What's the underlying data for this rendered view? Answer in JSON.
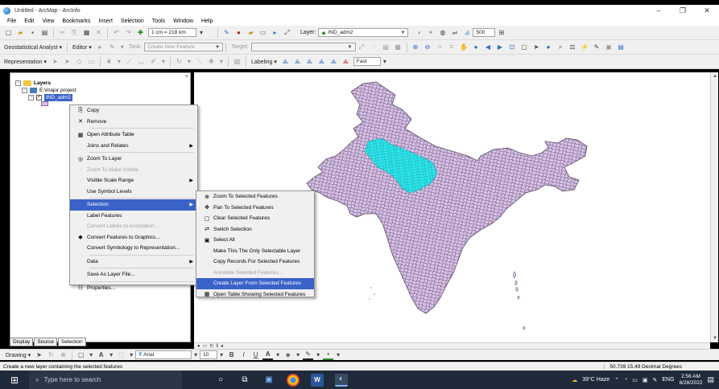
{
  "window": {
    "title": "Untitled - ArcMap - ArcInfo",
    "minimize": "–",
    "maximize": "❐",
    "close": "✕"
  },
  "menubar": [
    "File",
    "Edit",
    "View",
    "Bookmarks",
    "Insert",
    "Selection",
    "Tools",
    "Window",
    "Help"
  ],
  "toolbar1": {
    "scale": "1 cm = 218 km",
    "layer_label": "Layer:",
    "layer_value": "IND_adm2",
    "zoom_value": "500"
  },
  "toolbar2": {
    "geostat_label": "Geostatistical Analyst ▾",
    "editor_label": "Editor ▾",
    "task_label": "Task:",
    "task_value": "Create New Feature",
    "target_label": "Target:"
  },
  "toolbar3": {
    "representation_label": "Representation ▾",
    "labeling_label": "Labeling ▾",
    "fast_value": "Fast"
  },
  "toc": {
    "root": "Layers",
    "folder": "E:\\major project",
    "layer": "IND_adm2"
  },
  "toc_tabs": [
    "Display",
    "Source",
    "Selection"
  ],
  "context_menu": [
    {
      "label": "Copy",
      "icon": "copy-icon",
      "glyph": "⎘",
      "disabled": false,
      "submenu": false
    },
    {
      "label": "Remove",
      "icon": "remove-icon",
      "glyph": "✕",
      "disabled": false,
      "submenu": false
    },
    {
      "sep": true
    },
    {
      "label": "Open Attribute Table",
      "icon": "table-icon",
      "glyph": "▦",
      "disabled": false,
      "submenu": false
    },
    {
      "label": "Joins and Relates",
      "icon": "",
      "glyph": "",
      "disabled": false,
      "submenu": true
    },
    {
      "sep": true
    },
    {
      "label": "Zoom To Layer",
      "icon": "zoom-layer-icon",
      "glyph": "◎",
      "disabled": false,
      "submenu": false
    },
    {
      "label": "Zoom To Make Visible",
      "icon": "zoom-visible-icon",
      "glyph": "◌",
      "disabled": true,
      "submenu": false
    },
    {
      "label": "Visible Scale Range",
      "icon": "",
      "glyph": "",
      "disabled": false,
      "submenu": true
    },
    {
      "label": "Use Symbol Levels",
      "icon": "",
      "glyph": "",
      "disabled": false,
      "submenu": false
    },
    {
      "sep": true
    },
    {
      "label": "Selection",
      "icon": "",
      "glyph": "",
      "disabled": false,
      "submenu": true,
      "highlight": true
    },
    {
      "label": "Label Features",
      "icon": "",
      "glyph": "",
      "disabled": false,
      "submenu": false
    },
    {
      "label": "Convert Labels to Annotation...",
      "icon": "",
      "glyph": "",
      "disabled": true,
      "submenu": false
    },
    {
      "label": "Convert Features to Graphics...",
      "icon": "convert-graphics-icon",
      "glyph": "◆",
      "disabled": false,
      "submenu": false
    },
    {
      "label": "Convert Symbology to Representation...",
      "icon": "",
      "glyph": "",
      "disabled": false,
      "submenu": false
    },
    {
      "sep": true
    },
    {
      "label": "Data",
      "icon": "",
      "glyph": "",
      "disabled": false,
      "submenu": true
    },
    {
      "sep": true
    },
    {
      "label": "Save As Layer File...",
      "icon": "",
      "glyph": "",
      "disabled": false,
      "submenu": false
    },
    {
      "sep": true
    },
    {
      "label": "Properties...",
      "icon": "properties-icon",
      "glyph": "☷",
      "disabled": false,
      "submenu": false
    }
  ],
  "selection_submenu": [
    {
      "label": "Zoom To Selected Features",
      "icon": "zoom-selected-icon",
      "glyph": "⊕",
      "disabled": false
    },
    {
      "label": "Pan To Selected Features",
      "icon": "pan-selected-icon",
      "glyph": "✥",
      "disabled": false
    },
    {
      "label": "Clear Selected Features",
      "icon": "clear-selection-icon",
      "glyph": "▢",
      "disabled": false
    },
    {
      "label": "Switch Selection",
      "icon": "switch-selection-icon",
      "glyph": "⇄",
      "disabled": false
    },
    {
      "label": "Select All",
      "icon": "select-all-icon",
      "glyph": "▣",
      "disabled": false
    },
    {
      "label": "Make This The Only Selectable Layer",
      "icon": "",
      "glyph": "",
      "disabled": false
    },
    {
      "label": "Copy Records For Selected Features",
      "icon": "",
      "glyph": "",
      "disabled": false
    },
    {
      "label": "Annotate Selected Features...",
      "icon": "",
      "glyph": "",
      "disabled": true
    },
    {
      "label": "Create Layer From Selected Features",
      "icon": "",
      "glyph": "",
      "disabled": false,
      "highlight": true
    },
    {
      "label": "Open Table Showing Selected Features",
      "icon": "open-table-icon",
      "glyph": "▦",
      "disabled": false
    }
  ],
  "drawing_toolbar": {
    "drawing_label": "Drawing ▾",
    "font_value": "Arial",
    "size_value": "10"
  },
  "status": {
    "message": "Create a new layer containing the selected features",
    "coords": "50.739  15.49 Decimal Degrees"
  },
  "taskbar": {
    "search_placeholder": "Type here to search",
    "weather": "39°C  Haze",
    "lang": "ENG",
    "time": "2:56 AM",
    "date": "6/28/2022"
  },
  "colors": {
    "map_fill": "#d9c1e8",
    "map_stroke": "#5a4a66",
    "selected_fill": "#2ee8ec",
    "menu_highlight": "#3a62c8"
  }
}
